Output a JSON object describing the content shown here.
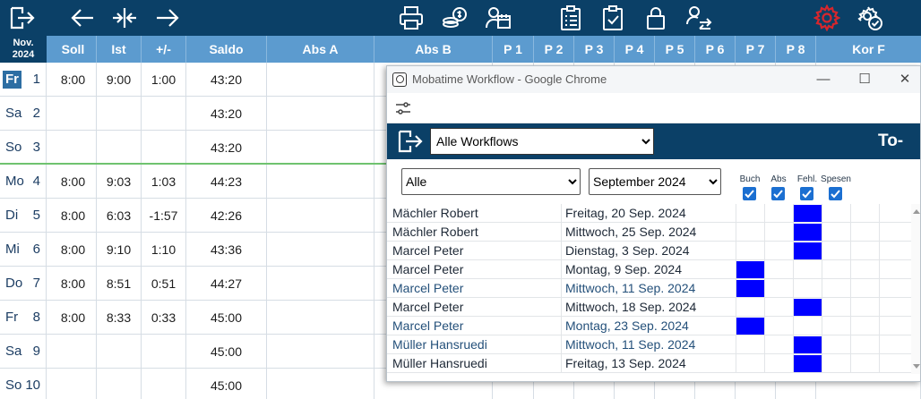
{
  "month_header": {
    "line1": "Nov.",
    "line2": "2024"
  },
  "columns": [
    "Soll",
    "Ist",
    "+/-",
    "Saldo",
    "Abs A",
    "Abs B",
    "P 1",
    "P 2",
    "P 3",
    "P 4",
    "P 5",
    "P 6",
    "P 7",
    "P 8",
    "Kor F"
  ],
  "rows": [
    {
      "day": "Fr",
      "num": "1",
      "soll": "8:00",
      "ist": "9:00",
      "diff": "1:00",
      "saldo": "43:20",
      "today": true
    },
    {
      "day": "Sa",
      "num": "2",
      "soll": "",
      "ist": "",
      "diff": "",
      "saldo": "43:20"
    },
    {
      "day": "So",
      "num": "3",
      "soll": "",
      "ist": "",
      "diff": "",
      "saldo": "43:20"
    },
    {
      "day": "Mo",
      "num": "4",
      "soll": "8:00",
      "ist": "9:03",
      "diff": "1:03",
      "saldo": "44:23"
    },
    {
      "day": "Di",
      "num": "5",
      "soll": "8:00",
      "ist": "6:03",
      "diff": "-1:57",
      "saldo": "42:26"
    },
    {
      "day": "Mi",
      "num": "6",
      "soll": "8:00",
      "ist": "9:10",
      "diff": "1:10",
      "saldo": "43:36"
    },
    {
      "day": "Do",
      "num": "7",
      "soll": "8:00",
      "ist": "8:51",
      "diff": "0:51",
      "saldo": "44:27"
    },
    {
      "day": "Fr",
      "num": "8",
      "soll": "8:00",
      "ist": "8:33",
      "diff": "0:33",
      "saldo": "45:00"
    },
    {
      "day": "Sa",
      "num": "9",
      "soll": "",
      "ist": "",
      "diff": "",
      "saldo": "45:00"
    },
    {
      "day": "So",
      "num": "10",
      "soll": "",
      "ist": "",
      "diff": "",
      "saldo": "45:00"
    }
  ],
  "toolbar_icons": [
    "exit-icon",
    "arrow-left-icon",
    "collapse-icon",
    "arrow-right-icon",
    "printer-icon",
    "coins-icon",
    "person-calendar-icon",
    "clipboard-list-icon",
    "clipboard-check-icon",
    "lock-icon",
    "users-swap-icon",
    "gear-icon",
    "gear-check-icon"
  ],
  "popup": {
    "window_title": "Mobatime Workflow - Google Chrome",
    "minimize": "—",
    "maximize": "☐",
    "close": "✕",
    "workflow_select": {
      "value": "Alle Workflows",
      "options": [
        "Alle Workflows"
      ]
    },
    "heading": "To-do",
    "filter_person": {
      "value": "Alle",
      "options": [
        "Alle"
      ]
    },
    "filter_month": {
      "value": "September 2024",
      "options": [
        "September 2024"
      ]
    },
    "check_columns": [
      {
        "label": "Buch",
        "checked": true
      },
      {
        "label": "Abs",
        "checked": true
      },
      {
        "label": "Fehl.",
        "checked": true
      },
      {
        "label": "Spesen",
        "checked": true
      }
    ],
    "items": [
      {
        "name": "Mächler Robert",
        "date": "Freitag, 20 Sep. 2024",
        "marks": [
          false,
          false,
          true,
          false
        ],
        "link": false
      },
      {
        "name": "Mächler Robert",
        "date": "Mittwoch, 25 Sep. 2024",
        "marks": [
          false,
          false,
          true,
          false
        ],
        "link": false
      },
      {
        "name": "Marcel Peter",
        "date": "Dienstag, 3 Sep. 2024",
        "marks": [
          false,
          false,
          true,
          false
        ],
        "link": false
      },
      {
        "name": "Marcel Peter",
        "date": "Montag, 9 Sep. 2024",
        "marks": [
          true,
          false,
          false,
          false
        ],
        "link": false
      },
      {
        "name": "Marcel Peter",
        "date": "Mittwoch, 11 Sep. 2024",
        "marks": [
          true,
          false,
          false,
          false
        ],
        "link": true
      },
      {
        "name": "Marcel Peter",
        "date": "Mittwoch, 18 Sep. 2024",
        "marks": [
          false,
          false,
          true,
          false
        ],
        "link": false
      },
      {
        "name": "Marcel Peter",
        "date": "Montag, 23 Sep. 2024",
        "marks": [
          true,
          false,
          false,
          false
        ],
        "link": true
      },
      {
        "name": "Müller Hansruedi",
        "date": "Mittwoch, 11 Sep. 2024",
        "marks": [
          false,
          false,
          true,
          false
        ],
        "link": true
      },
      {
        "name": "Müller Hansruedi",
        "date": "Freitag, 13 Sep. 2024",
        "marks": [
          false,
          false,
          true,
          false
        ],
        "link": false
      }
    ],
    "colors": {
      "mark": "#0000ff",
      "header": "#0b4067"
    }
  },
  "colors": {
    "toolbar": "#0b4067",
    "column_header": "#5c9bcf",
    "week_separator": "#6fc36f",
    "gear_accent": "#d8262c"
  }
}
